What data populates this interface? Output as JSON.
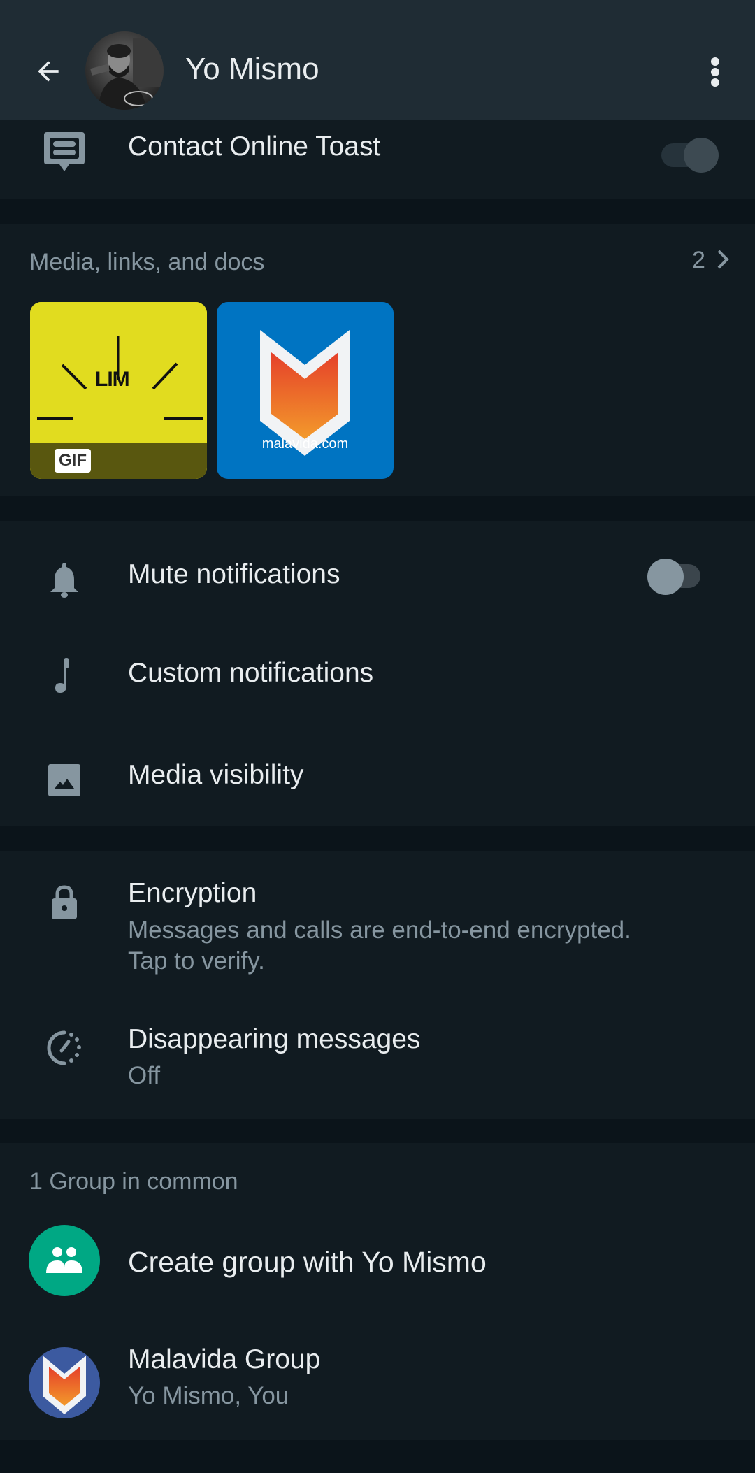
{
  "header": {
    "title": "Yo Mismo",
    "back_icon": "arrow-left-icon",
    "avatar": "contact-profile-photo",
    "menu_icon": "more-vertical-icon"
  },
  "contact_online_toast": {
    "label": "Contact Online Toast",
    "icon": "message-toast-icon",
    "enabled": true
  },
  "media": {
    "label": "Media, links, and docs",
    "count": "2",
    "chevron_icon": "chevron-right-icon",
    "items": [
      {
        "type": "gif",
        "badge": "GIF",
        "caption": "LIM",
        "bg_color": "#e1dc1f"
      },
      {
        "type": "image",
        "caption": "malavida.com",
        "bg_color": "#0074c2"
      }
    ]
  },
  "notifications": {
    "mute": {
      "label": "Mute notifications",
      "icon": "bell-icon",
      "enabled": false
    },
    "custom": {
      "label": "Custom notifications",
      "icon": "music-note-icon"
    },
    "visibility": {
      "label": "Media visibility",
      "icon": "image-icon"
    }
  },
  "privacy": {
    "encryption": {
      "label": "Encryption",
      "description_line1": "Messages and calls are end-to-end encrypted.",
      "description_line2": "Tap to verify.",
      "icon": "lock-icon"
    },
    "disappearing": {
      "label": "Disappearing messages",
      "value": "Off",
      "icon": "timer-icon"
    }
  },
  "groups": {
    "label": "1 Group in common",
    "create": {
      "label": "Create group with Yo Mismo",
      "icon": "group-add-icon",
      "color": "#00a884"
    },
    "items": [
      {
        "name": "Malavida Group",
        "members": "Yo Mismo, You",
        "avatar_color": "#3c5aa0"
      }
    ]
  },
  "colors": {
    "header_bg": "#1f2c34",
    "section_bg": "#111b21",
    "divider_bg": "#0b141a",
    "primary_text": "#e9edef",
    "secondary_text": "#8696a0",
    "accent": "#00a884"
  }
}
